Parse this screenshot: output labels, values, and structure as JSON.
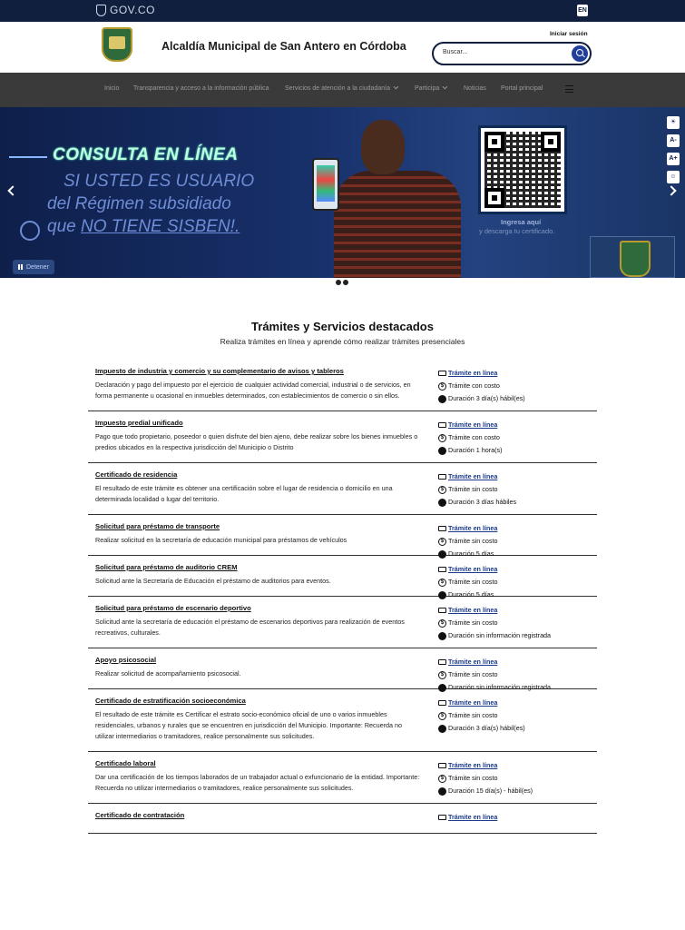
{
  "govbar": {
    "logo_text": "GOV.CO",
    "lang": "EN"
  },
  "header": {
    "site_title": "Alcaldía Municipal de San Antero en Córdoba",
    "login": "Iniciar sesión",
    "search_placeholder": "Buscar..."
  },
  "nav": {
    "items": [
      {
        "label": "Inicio"
      },
      {
        "label": "Transparencia y acceso a la información pública"
      },
      {
        "label": "Servicios de atención a la ciudadanía"
      },
      {
        "label": "Participa"
      },
      {
        "label": "Noticias"
      },
      {
        "label": "Portal principal"
      }
    ]
  },
  "banner": {
    "line1": "CONSULTA EN LÍNEA",
    "line2": "SI USTED ES USUARIO",
    "line3": "del Régimen subsidiado",
    "line4_pre": "que ",
    "line4_u": "NO TIENE SISBEN!.",
    "qr_label1": "Ingresa aquí",
    "qr_label2": "y descarga tu certificado.",
    "stop": "Detener",
    "a11y": [
      "☀",
      "A-",
      "A+",
      "☺"
    ]
  },
  "section": {
    "title": "Trámites y Servicios destacados",
    "subtitle": "Realiza trámites en línea y aprende cómo realizar trámites presenciales"
  },
  "procedures": [
    {
      "name": "Impuesto de industria y comercio y su complementario de avisos y tableros",
      "desc": "Declaración y pago del impuesto por el ejercicio de cualquier actividad comercial, industrial o de servicios, en forma permanente u ocasional en inmuebles determinados, con establecimientos de comercio o sin ellos.",
      "mode": "Trámite en línea",
      "cost": "Trámite con costo",
      "duration": "Duración 3 día(s) hábil(es)"
    },
    {
      "name": "Impuesto predial unificado",
      "desc": "Pago que todo propietario, poseedor o quien disfrute del bien ajeno, debe realizar sobre los bienes inmuebles o predios ubicados en la respectiva jurisdicción del Municipio o Distrito",
      "mode": "Trámite en línea",
      "cost": "Trámite con costo",
      "duration": "Duración 1 hora(s)"
    },
    {
      "name": "Certificado de residencia",
      "desc": "El resultado de este trámite es obtener una certificación sobre el lugar de residencia o domicilio en una determinada localidad o lugar del territorio.",
      "mode": "Trámite en línea",
      "cost": "Trámite sin costo",
      "duration": "Duración 3 días hábiles"
    },
    {
      "name": "Solicitud para préstamo de transporte",
      "desc": "Realizar solicitud en la secretaría de educación municipal para préstamos de vehículos",
      "mode": "Trámite en línea",
      "cost": "Trámite sin costo",
      "duration": "Duración 5 días"
    },
    {
      "name": "Solicitud para préstamo de auditorio CREM",
      "desc": "Solicitud ante la Secretaría de Educación el préstamo de auditorios para eventos.",
      "mode": "Trámite en línea",
      "cost": "Trámite sin costo",
      "duration": "Duración 5 días"
    },
    {
      "name": "Solicitud para préstamo de escenario deportivo",
      "desc": "Solicitud ante la secretaría de educación el préstamo de escenarios deportivos para realización de eventos recreativos, culturales.",
      "mode": "Trámite en línea",
      "cost": "Trámite sin costo",
      "duration": "Duración sin información registrada"
    },
    {
      "name": "Apoyo psicosocial",
      "desc": "Realizar solicitud de acompañamiento psicosocial.",
      "mode": "Trámite en línea",
      "cost": "Trámite sin costo",
      "duration": "Duración sin información registrada"
    },
    {
      "name": "Certificado de estratificación socioeconómica",
      "desc": "El resultado de este trámite es Certificar el estrato socio-económico oficial de uno o varios inmuebles residenciales, urbanos y rurales que se encuentren en jurisdicción del Municipio. Importante: Recuerda no utilizar intermediarios o tramitadores, realice personalmente sus solicitudes.",
      "mode": "Trámite en línea",
      "cost": "Trámite sin costo",
      "duration": "Duración 3 día(s) hábil(es)"
    },
    {
      "name": "Certificado laboral",
      "desc": "Dar una certificación de los tiempos laborados de un trabajador actual o exfuncionario de la entidad. Importante: Recuerda no utilizar intermediarios o tramitadores, realice personalmente sus solicitudes.",
      "mode": "Trámite en línea",
      "cost": "Trámite sin costo",
      "duration": "Duración 15 día(s) - hábil(es)"
    },
    {
      "name": "Certificado de contratación",
      "desc": "",
      "mode": "Trámite en línea",
      "cost": "",
      "duration": ""
    }
  ]
}
